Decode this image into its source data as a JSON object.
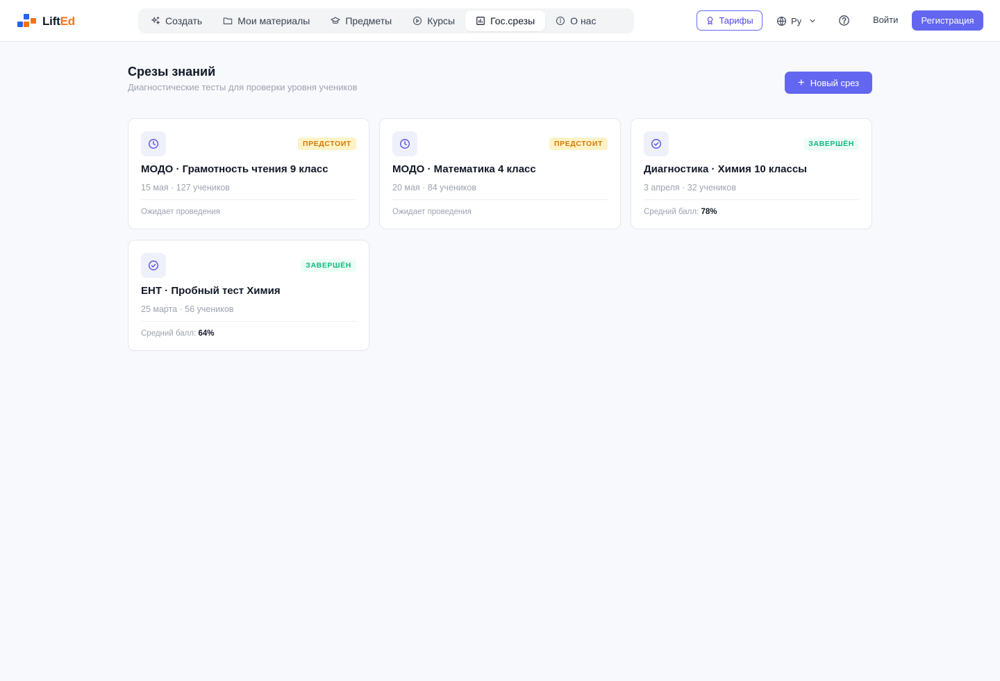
{
  "brand": {
    "name_main": "Lift",
    "name_accent": "Ed"
  },
  "nav": {
    "items": [
      {
        "label": "Создать",
        "icon": "sparkles-icon"
      },
      {
        "label": "Мои материалы",
        "icon": "folder-icon"
      },
      {
        "label": "Предметы",
        "icon": "graduation-cap-icon"
      },
      {
        "label": "Курсы",
        "icon": "play-circle-icon"
      },
      {
        "label": "Гос.срезы",
        "icon": "bar-chart-icon",
        "active": true
      },
      {
        "label": "О нас",
        "icon": "info-icon"
      }
    ]
  },
  "header": {
    "tariffs_label": "Тарифы",
    "lang_label": "Ру",
    "login_label": "Войти",
    "register_label": "Регистрация"
  },
  "main": {
    "title": "Срезы знаний",
    "subtitle": "Диагностические тесты для проверки уровня учеников",
    "new_button_label": "Новый срез"
  },
  "cards": [
    {
      "status": "upcoming",
      "badge": "ПРЕДСТОИТ",
      "title": "МОДО · Грамотность чтения 9 класс",
      "meta": "15 мая · 127 учеников",
      "footer_text": "Ожидает проведения",
      "footer_value": ""
    },
    {
      "status": "upcoming",
      "badge": "ПРЕДСТОИТ",
      "title": "МОДО · Математика 4 класс",
      "meta": "20 мая · 84 учеников",
      "footer_text": "Ожидает проведения",
      "footer_value": ""
    },
    {
      "status": "done",
      "badge": "ЗАВЕРШЁН",
      "title": "Диагностика · Химия 10 классы",
      "meta": "3 апреля · 32 учеников",
      "footer_text": "Средний балл:",
      "footer_value": "78%"
    },
    {
      "status": "done",
      "badge": "ЗАВЕРШЁН",
      "title": "ЕНТ · Пробный тест Химия",
      "meta": "25 марта · 56 учеников",
      "footer_text": "Средний балл:",
      "footer_value": "64%"
    }
  ],
  "colors": {
    "accent": "#6366f1",
    "upcoming_badge_bg": "#fef3c7",
    "upcoming_badge_text": "#d97706",
    "done_badge_bg": "#ecfdf5",
    "done_badge_text": "#10b981",
    "logo_blue": "#2563eb",
    "logo_orange": "#f97316"
  }
}
